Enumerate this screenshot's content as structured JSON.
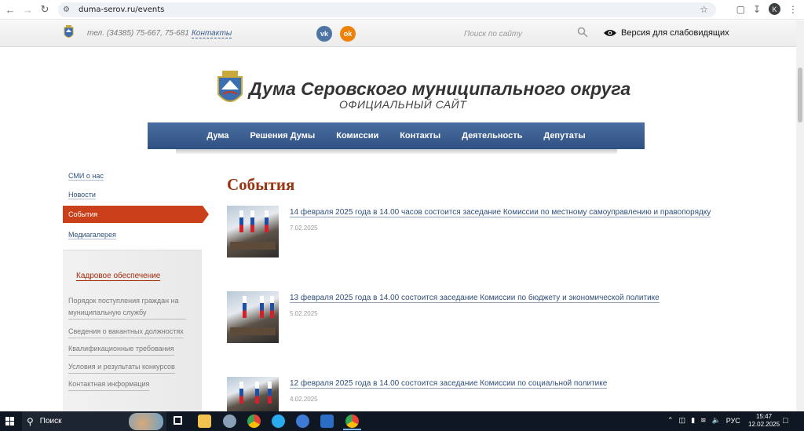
{
  "browser": {
    "url": "duma-serov.ru/events",
    "profile_initial": "K"
  },
  "topbar": {
    "phone": "тел. (34385) 75-667, 75-681",
    "contacts_link": "Контакты",
    "vk_label": "vk",
    "ok_label": "ok",
    "search_placeholder": "Поиск по сайту",
    "vision_label": "Версия для слабовидящих"
  },
  "header": {
    "title": "Дума Серовского муниципального округа",
    "subtitle": "ОФИЦИАЛЬНЫЙ САЙТ"
  },
  "menu": [
    "Дума",
    "Решения Думы",
    "Комиссии",
    "Контакты",
    "Деятельность",
    "Депутаты"
  ],
  "sidebar": {
    "items": [
      "СМИ о нас",
      "Новости",
      "События",
      "Медиагалерея"
    ],
    "active_index": 2,
    "box_title": "Кадровое обеспечение",
    "box_links": [
      "Порядок поступления граждан на муниципальную службу",
      "Сведения о вакантных должностях",
      "Квалификационные требования",
      "Условия и результаты конкурсов",
      "Контактная информация"
    ]
  },
  "content": {
    "page_title": "События",
    "events": [
      {
        "title": "14 февраля 2025 года в 14.00 часов состоится заседание Комиссии по местному самоуправлению и правопорядку",
        "date": "7.02.2025"
      },
      {
        "title": "13 февраля 2025 года в 14.00 состоится заседание Комиссии по бюджету и экономической политике",
        "date": "5.02.2025"
      },
      {
        "title": "12 февраля 2025 года в 14.00 состоится заседание Комиссии по социальной политике",
        "date": "4.02.2025"
      }
    ]
  },
  "taskbar": {
    "search_label": "Поиск",
    "language": "РУС",
    "time": "15:47",
    "date": "12.02.2025"
  },
  "colors": {
    "menu_blue": "#3a5d92",
    "accent_red": "#c9401a",
    "link_blue": "#2f4f7a"
  }
}
